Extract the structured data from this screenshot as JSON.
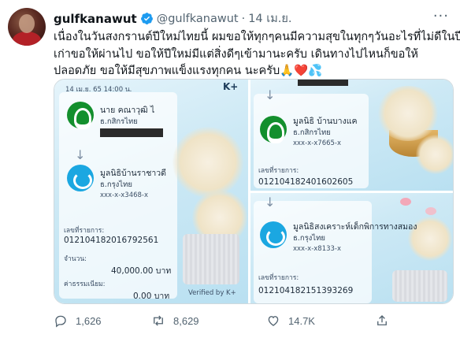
{
  "tweet": {
    "display_name": "gulfkanawut",
    "handle": "@gulfkanawut",
    "separator": "·",
    "date": "14 เม.ย.",
    "more_label": "···",
    "text_lines": [
      "เนื่องในวันสงกรานต์ปีใหม่ไทยนี้ ผมขอให้ทุกๆคนมีความสุขในทุกๆวันอะไรที่ไม่ดีในปี",
      "เก่าขอให้ผ่านไป ขอให้ปีใหม่มีแต่สิ่งดีๆเข้ามานะครับ เดินทางไปไหนก็ขอให้",
      "ปลอดภัย  ขอให้มีสุขภาพแข็งแรงทุกคน นะครับ🙏❤️💦"
    ]
  },
  "slip_a": {
    "date": "14 เม.ย. 65  14:00 น.",
    "brand": "K+",
    "sender_name": "นาย คณาวุฒิ ไ",
    "sender_bank": "ธ.กสิกรไทย",
    "receiver_name": "มูลนิธิบ้านราชาวดี",
    "receiver_bank": "ธ.กรุงไทย",
    "receiver_account": "xxx-x-x3468-x",
    "ref_label": "เลขที่รายการ:",
    "ref_value": "012104182016792561",
    "amount_label": "จำนวน:",
    "amount_value": "40,000.00 บาท",
    "fee_label": "ค่าธรรมเนียม:",
    "fee_value": "0.00 บาท",
    "verified_label": "Verified by K+"
  },
  "slip_b": {
    "receiver_name": "มูลนิธิ บ้านบางแค",
    "receiver_bank": "ธ.กสิกรไทย",
    "receiver_account": "xxx-x-x7665-x",
    "ref_label": "เลขที่รายการ:",
    "ref_value": "012104182401602605"
  },
  "slip_c": {
    "receiver_name": "มูลนิธิสงเคราะห์เด็กพิการทางสมอง",
    "receiver_bank": "ธ.กรุงไทย",
    "receiver_account": "xxx-x-x8133-x",
    "ref_label": "เลขที่รายการ:",
    "ref_value": "012104182151393269"
  },
  "actions": {
    "replies": "1,626",
    "retweets": "8,629",
    "likes": "14.7K"
  },
  "colors": {
    "verified_badge": "#1d9bf0",
    "secondary_text": "#536471",
    "slip_background": "#cde9f5"
  }
}
